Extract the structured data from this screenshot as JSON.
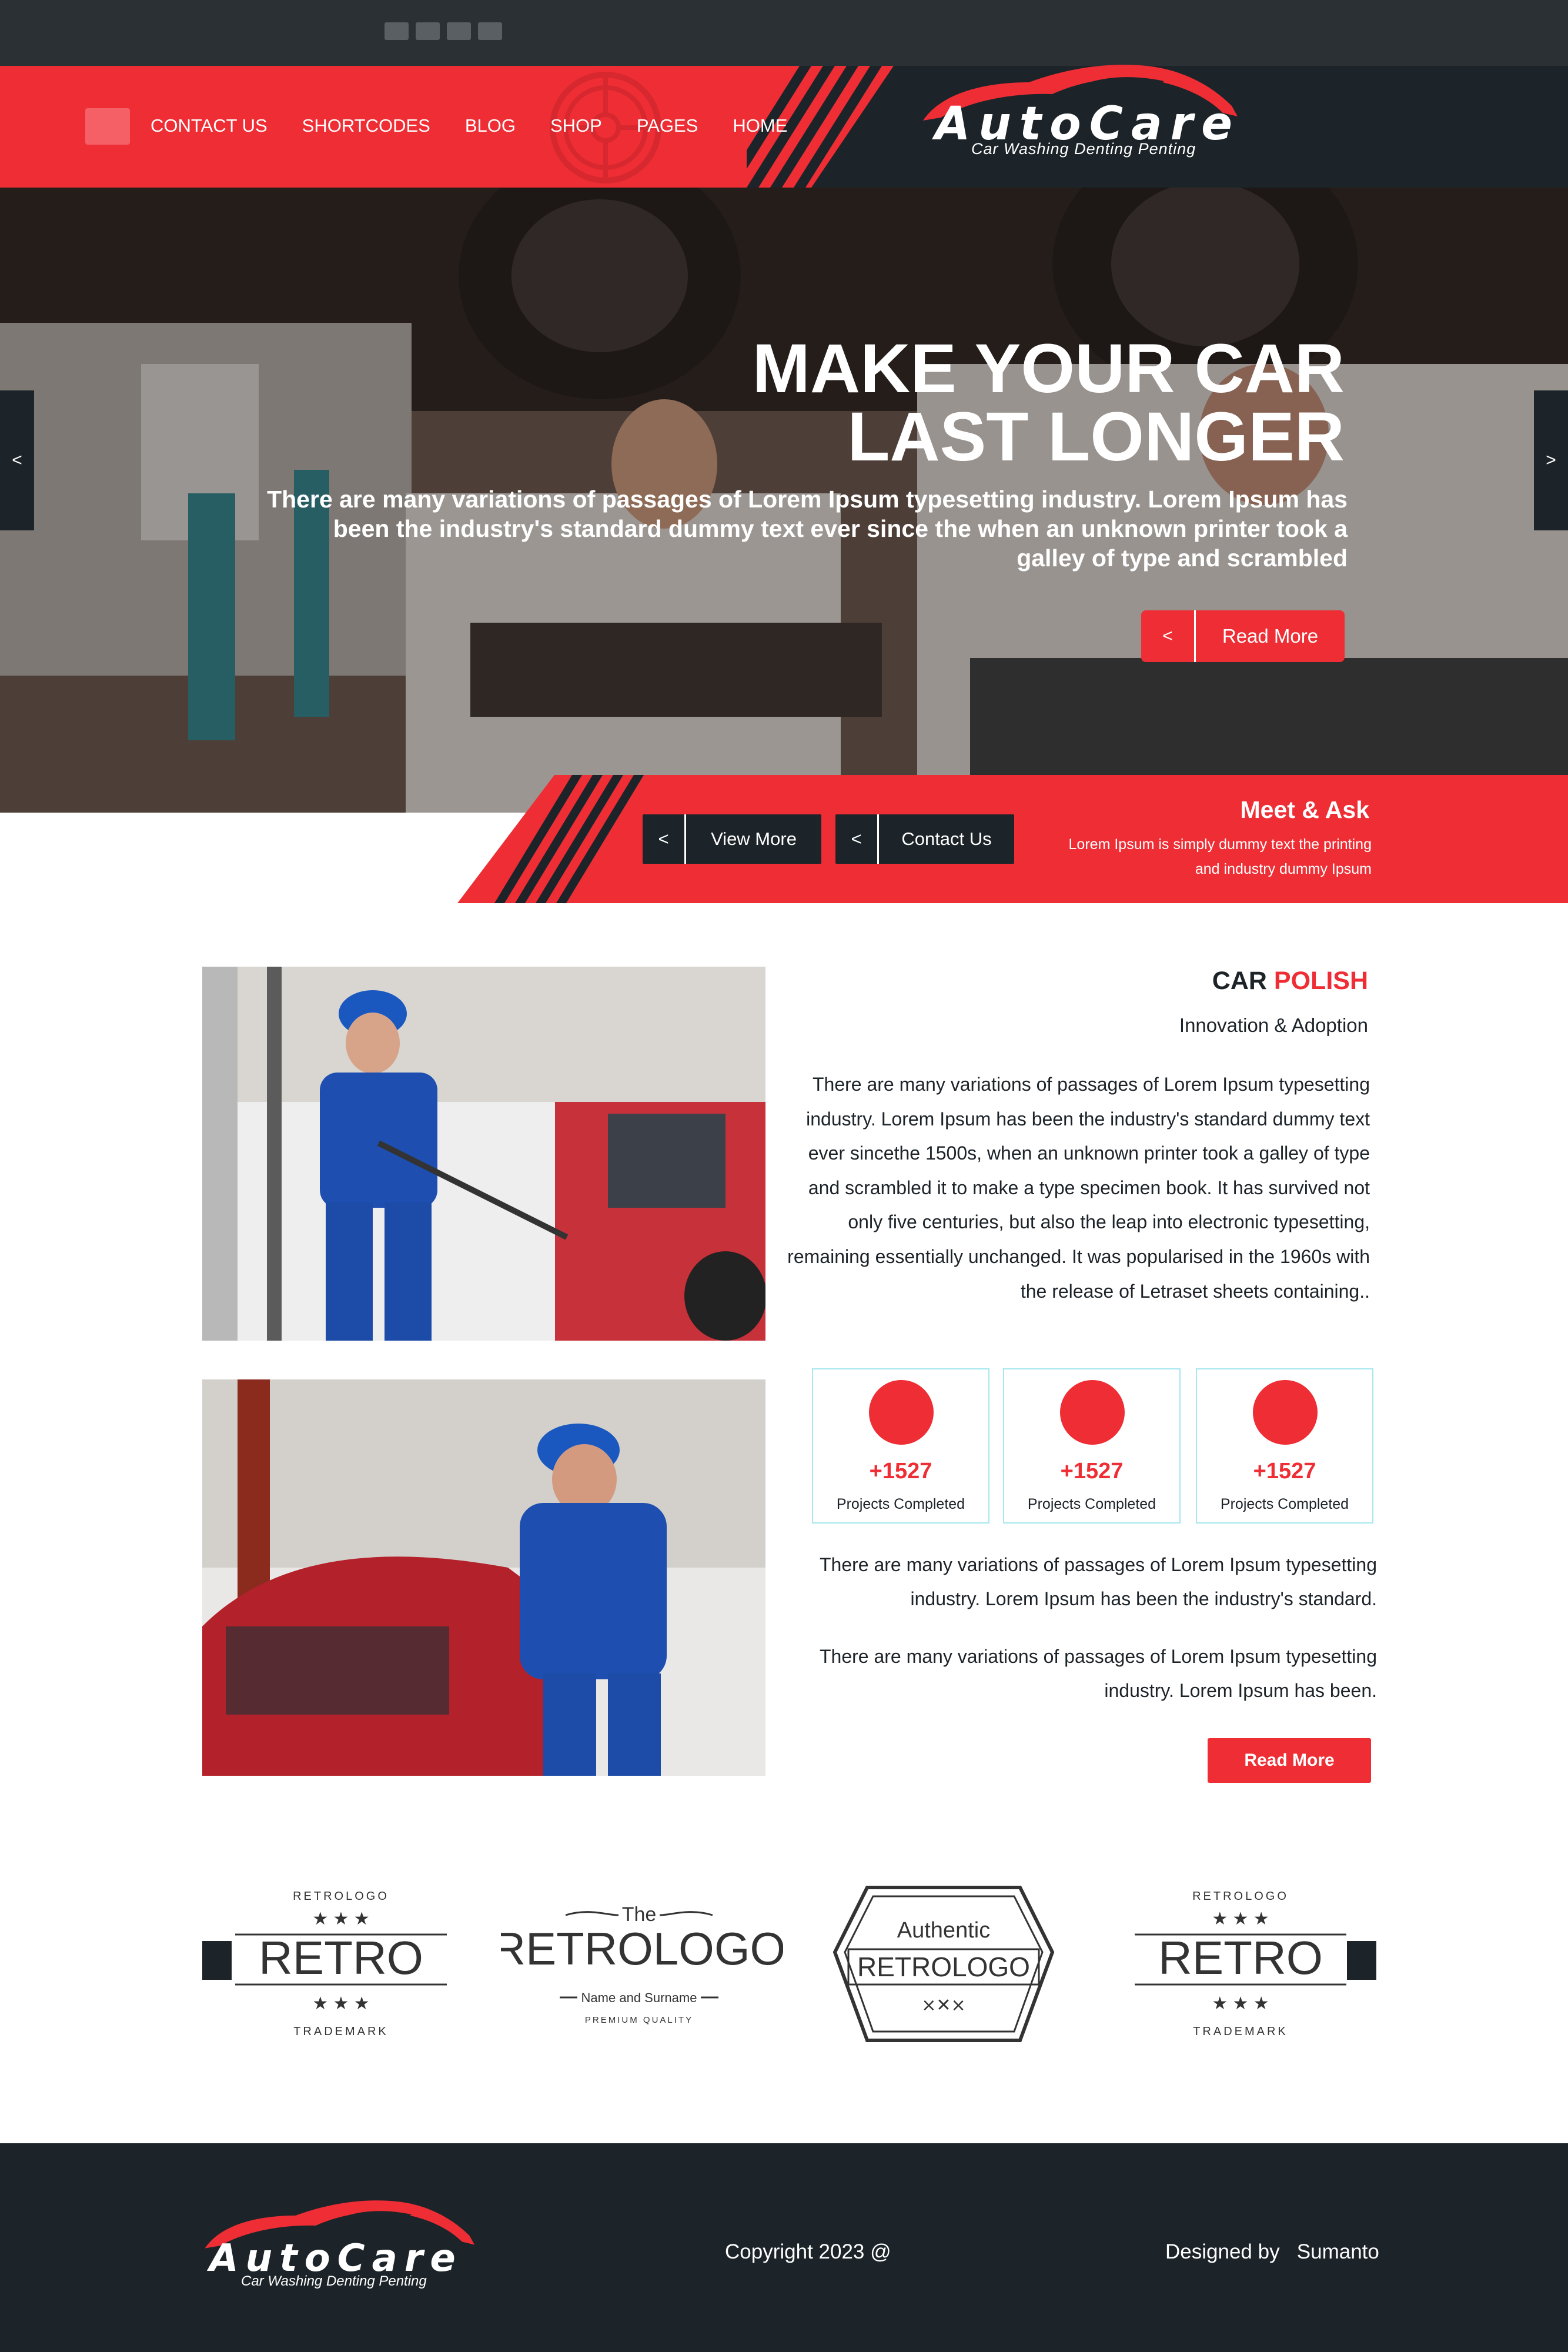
{
  "brand": {
    "name": "AutoCare",
    "tagline": "Car Washing Denting Penting",
    "accent_color": "#ee2d34",
    "dark_color": "#1c2429"
  },
  "nav": {
    "menu_icon": "hamburger-icon",
    "items": [
      {
        "label": "CONTACT US"
      },
      {
        "label": "SHORTCODES"
      },
      {
        "label": "BLOG"
      },
      {
        "label": "SHOP"
      },
      {
        "label": "PAGES"
      },
      {
        "label": "HOME"
      }
    ]
  },
  "hero": {
    "title_line1": "MAKE YOUR CAR",
    "title_line2": "LAST LONGER",
    "text": "There are many variations of passages of Lorem Ipsum typesetting industry. Lorem Ipsum has been the industry's standard dummy text ever since the  when an unknown printer took a galley of type and scrambled",
    "read_more_arrow": "<",
    "read_more_label": "Read More",
    "prev_arrow": "<",
    "next_arrow": ">"
  },
  "band": {
    "view_more_arrow": "<",
    "view_more_label": "View More",
    "contact_arrow": "<",
    "contact_label": "Contact Us",
    "meet_title": "Meet & Ask",
    "meet_text": "Lorem Ipsum is simply dummy text the printing and industry dummy Ipsum"
  },
  "polish": {
    "title_part1": "CAR",
    "title_part2": "POLISH",
    "subtitle": "Innovation & Adoption",
    "para1": "There are many variations of passages of Lorem Ipsum typesetting industry. Lorem Ipsum has been the industry's standard dummy text ever sincethe 1500s,  when an unknown printer took a galley of type and scrambled it to make a type specimen book. It has survived not only five  centuries, but also the leap into electronic typesetting, remaining essentially unchanged. It was popularised in the 1960s with the release of Letraset sheets containing..",
    "stats": [
      {
        "value": "+1527",
        "label": "Projects Completed"
      },
      {
        "value": "+1527",
        "label": "Projects Completed"
      },
      {
        "value": "+1527",
        "label": "Projects Completed"
      }
    ],
    "para2": "There are many variations of passages of Lorem Ipsum typesetting industry. Lorem Ipsum has been the industry's standard.",
    "para3": "There are many variations of passages of Lorem Ipsum typesetting industry. Lorem Ipsum has been.",
    "button": "Read More"
  },
  "logos": [
    {
      "top": "RETROLOGO",
      "main": "RETRO",
      "bottom": "TRADEMARK"
    },
    {
      "top": "The",
      "main": "RETROLOGO",
      "sub": "Name and Surname",
      "bottom": "PREMIUM QUALITY"
    },
    {
      "top": "Authentic",
      "main": "RETROLOGO",
      "bottom": "×✕×"
    },
    {
      "top": "RETROLOGO",
      "main": "RETRO",
      "bottom": "TRADEMARK"
    }
  ],
  "footer": {
    "copyright": "Copyright 2023 @",
    "designed_label": "Designed by",
    "designer": "Sumanto"
  }
}
